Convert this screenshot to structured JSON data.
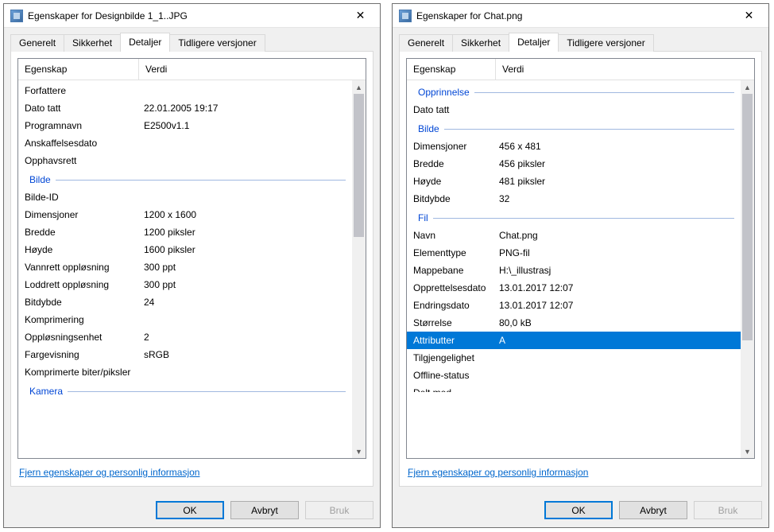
{
  "dialog1": {
    "title": "Egenskaper for Designbilde 1_1..JPG",
    "tabs": {
      "generelt": "Generelt",
      "sikkerhet": "Sikkerhet",
      "detaljer": "Detaljer",
      "tidligere": "Tidligere versjoner"
    },
    "headers": {
      "property": "Egenskap",
      "value": "Verdi"
    },
    "rows": {
      "forfattere": "Forfattere",
      "dato_tatt": "Dato tatt",
      "dato_tatt_v": "22.01.2005 19:17",
      "programnavn": "Programnavn",
      "programnavn_v": "E2500v1.1",
      "anskaffelsesdato": "Anskaffelsesdato",
      "opphavsrett": "Opphavsrett",
      "sect_bilde": "Bilde",
      "bilde_id": "Bilde-ID",
      "dimensjoner": "Dimensjoner",
      "dimensjoner_v": "1200 x 1600",
      "bredde": "Bredde",
      "bredde_v": "1200 piksler",
      "hoyde": "Høyde",
      "hoyde_v": "1600 piksler",
      "vannrett": "Vannrett oppløsning",
      "vannrett_v": "300 ppt",
      "loddrett": "Loddrett oppløsning",
      "loddrett_v": "300 ppt",
      "bitdybde": "Bitdybde",
      "bitdybde_v": "24",
      "komprimering": "Komprimering",
      "opplosning": "Oppløsningsenhet",
      "opplosning_v": "2",
      "fargevisning": "Fargevisning",
      "fargevisning_v": "sRGB",
      "komprimerte": "Komprimerte biter/piksler",
      "sect_kamera": "Kamera"
    },
    "link": "Fjern egenskaper og personlig informasjon",
    "buttons": {
      "ok": "OK",
      "avbryt": "Avbryt",
      "bruk": "Bruk"
    }
  },
  "dialog2": {
    "title": "Egenskaper for Chat.png",
    "tabs": {
      "generelt": "Generelt",
      "sikkerhet": "Sikkerhet",
      "detaljer": "Detaljer",
      "tidligere": "Tidligere versjoner"
    },
    "headers": {
      "property": "Egenskap",
      "value": "Verdi"
    },
    "rows": {
      "sect_opprinnelse": "Opprinnelse",
      "dato_tatt": "Dato tatt",
      "sect_bilde": "Bilde",
      "dimensjoner": "Dimensjoner",
      "dimensjoner_v": "456 x 481",
      "bredde": "Bredde",
      "bredde_v": "456 piksler",
      "hoyde": "Høyde",
      "hoyde_v": "481 piksler",
      "bitdybde": "Bitdybde",
      "bitdybde_v": "32",
      "sect_fil": "Fil",
      "navn": "Navn",
      "navn_v": "Chat.png",
      "elementtype": "Elementtype",
      "elementtype_v": "PNG-fil",
      "mappebane": "Mappebane",
      "mappebane_v": "H:\\_illustrasj",
      "opprettelsesdato": "Opprettelsesdato",
      "opprettelsesdato_v": "13.01.2017 12:07",
      "endringsdato": "Endringsdato",
      "endringsdato_v": "13.01.2017 12:07",
      "storrelse": "Størrelse",
      "storrelse_v": "80,0 kB",
      "attributter": "Attributter",
      "attributter_v": "A",
      "tilgjengelighet": "Tilgjengelighet",
      "offline": "Offline-status",
      "delt_med": "Delt med"
    },
    "link": "Fjern egenskaper og personlig informasjon",
    "buttons": {
      "ok": "OK",
      "avbryt": "Avbryt",
      "bruk": "Bruk"
    }
  }
}
